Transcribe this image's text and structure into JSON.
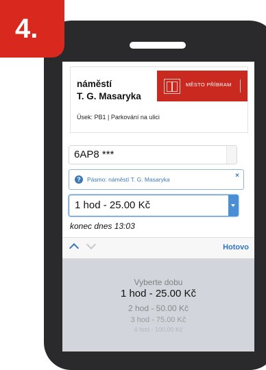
{
  "step": {
    "number": "4."
  },
  "zone_card": {
    "title": "náměstí\nT. G. Masaryka",
    "logo_text": "MĚSTO PŘÍBRAM",
    "segment": "Úsek: PB1 | Parkování na ulici"
  },
  "vehicle": {
    "plate": "6AP8 ***"
  },
  "zone_info": {
    "text": "Pásmo: náměstí T. G. Masaryka",
    "close": "×"
  },
  "duration": {
    "selected": "1 hod - 25.00 Kč",
    "end_time": "konec dnes 13:03"
  },
  "picker": {
    "done_label": "Hotovo",
    "items": [
      "Vyberte dobu",
      "1 hod - 25.00 Kč",
      "2 hod - 50.00 Kč",
      "3 hod - 75.00 Kč",
      "4 hod - 100.00 Kč"
    ]
  },
  "colors": {
    "brand_red": "#d9281e",
    "link_blue": "#2f72bd",
    "phone_body": "#2a2a2c"
  }
}
